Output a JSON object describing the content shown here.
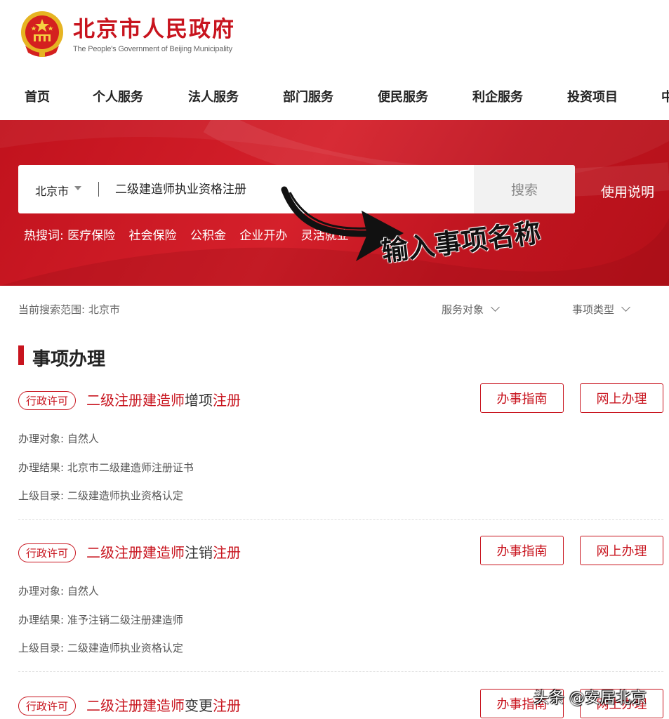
{
  "header": {
    "title": "北京市人民政府",
    "subtitle": "The People's Government of Beijing Municipality"
  },
  "nav": {
    "items": [
      "首页",
      "个人服务",
      "法人服务",
      "部门服务",
      "便民服务",
      "利企服务",
      "投资项目",
      "中"
    ]
  },
  "search": {
    "region": "北京市",
    "query": "二级建造师执业资格注册",
    "button_label": "搜索",
    "help_label": "使用说明",
    "hot_label": "热搜词:",
    "hot_terms": [
      "医疗保险",
      "社会保险",
      "公积金",
      "企业开办",
      "灵活就业"
    ]
  },
  "annotation": {
    "text": "输入事项名称"
  },
  "filters": {
    "scope": "当前搜索范围: 北京市",
    "service_target": "服务对象",
    "item_type": "事项类型"
  },
  "section": {
    "title": "事项办理"
  },
  "items": [
    {
      "tag": "行政许可",
      "title_prefix": "二级注册建造师",
      "title_middle": "增项",
      "title_suffix": "注册",
      "guide_label": "办事指南",
      "online_label": "网上办理",
      "target_label": "办理对象:",
      "target": "自然人",
      "result_label": "办理结果:",
      "result": "北京市二级建造师注册证书",
      "catalog_label": "上级目录:",
      "catalog": "二级建造师执业资格认定"
    },
    {
      "tag": "行政许可",
      "title_prefix": "二级注册建造师",
      "title_middle": "注销",
      "title_suffix": "注册",
      "guide_label": "办事指南",
      "online_label": "网上办理",
      "target_label": "办理对象:",
      "target": "自然人",
      "result_label": "办理结果:",
      "result": "准予注销二级注册建造师",
      "catalog_label": "上级目录:",
      "catalog": "二级建造师执业资格认定"
    },
    {
      "tag": "行政许可",
      "title_prefix": "二级注册建造师",
      "title_middle": "变更",
      "title_suffix": "注册",
      "guide_label": "办事指南",
      "online_label": "网上办理"
    }
  ],
  "watermark": "头条 @安居北京",
  "colors": {
    "brand_red": "#c8141e",
    "banner_red": "#d5202b"
  }
}
